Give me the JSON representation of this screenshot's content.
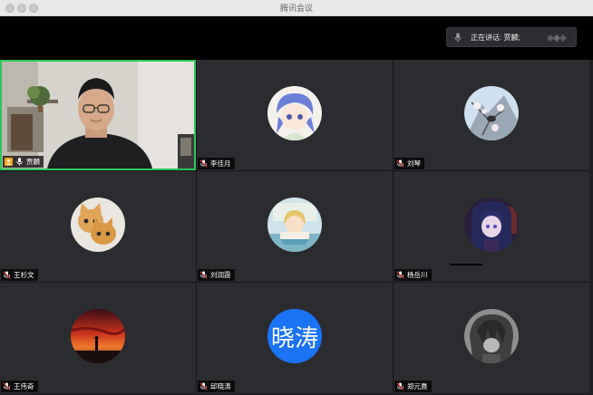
{
  "window": {
    "title": "腾讯会议"
  },
  "speaking": {
    "label": "正在讲话: 贾麟;"
  },
  "participants": [
    {
      "name": "贾麟",
      "type": "camera",
      "host": true,
      "muted": false,
      "active": true
    },
    {
      "name": "李佳月",
      "type": "avatar",
      "avatar": "anime-girl-blue-hair",
      "muted": true
    },
    {
      "name": "刘琴",
      "type": "avatar",
      "avatar": "bird-blossom",
      "muted": true
    },
    {
      "name": "王杉文",
      "type": "avatar",
      "avatar": "two-kittens",
      "muted": true
    },
    {
      "name": "刘润霞",
      "type": "avatar",
      "avatar": "anime-reading",
      "muted": true
    },
    {
      "name": "杨岳川",
      "type": "avatar",
      "avatar": "anime-dark-hair",
      "muted": true
    },
    {
      "name": "王伟奇",
      "type": "avatar",
      "avatar": "sunset-silhouette",
      "muted": true
    },
    {
      "name": "邱晓涛",
      "type": "text-avatar",
      "initials": "晓涛",
      "muted": true
    },
    {
      "name": "郑元熹",
      "type": "avatar",
      "avatar": "grayscale-anime",
      "muted": true
    }
  ],
  "colors": {
    "active_border": "#2fc65a",
    "text_avatar_bg": "#1b73f5",
    "host_badge": "#f5a623",
    "muted_icon": "#e23b3b"
  }
}
